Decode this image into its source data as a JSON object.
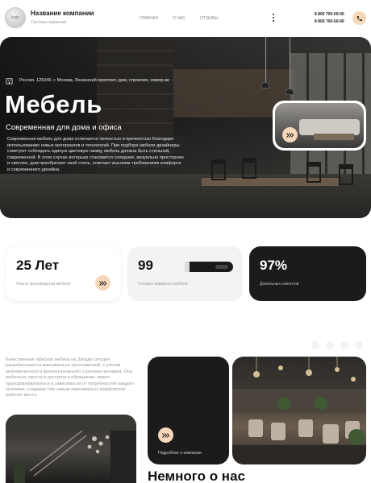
{
  "header": {
    "logo_text": "logo",
    "company_name": "Название компании",
    "company_tagline": "Системы хранения",
    "nav": [
      {
        "label": "Главная"
      },
      {
        "label": "О нас"
      },
      {
        "label": "Отзывы"
      }
    ],
    "phones": [
      "8 800 700-00-00",
      "8 800 700-00-00"
    ],
    "phone_icon": "phone-icon"
  },
  "hero": {
    "address": "Россия, 125040, г. Москва, Ленинский проспект, дом, строение, номер кв",
    "title": "Мебель",
    "subtitle": "Современная для дома и офиса",
    "text": "Современная мебель для дома отличается легкостью и прочностью благодаря использованию новых материалов и технологий. При подборе мебели дизайнеры советуют соблюдать единую цветовую гамму, мебель должна быть стильной, современной. В этом случае интерьер становится солиднее, визуально просторнее и светлее, дом приобретает свой стиль, отвечает высоким требованиям комфорта и современного дизайна.",
    "accent_color": "#f6d7b9"
  },
  "stats": [
    {
      "value": "25 Лет",
      "label": "Опыта производства мебели"
    },
    {
      "value": "99",
      "label": "Готовые варианты мебели"
    },
    {
      "value": "97%",
      "label": "Довольных клиентов"
    }
  ],
  "about": {
    "text": "Качественная офисная мебель на Западе сегодня разрабатывается максимально эргономичной, с учетом анатомического и физиологического строения человека. Она мобильна, проста и доступна в обращении; может трансформироваться в зависимости от потребностей каждого человека, создавая тем самым максимально комфортное рабочее место.",
    "card_label": "Подробнее о компании",
    "title": "Немного о нас"
  }
}
